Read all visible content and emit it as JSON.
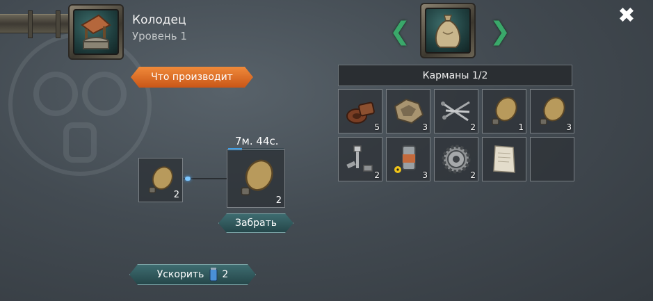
{
  "building": {
    "name": "Колодец",
    "level": "Уровень 1",
    "icon": "well-icon"
  },
  "produces_button": "Что производит",
  "close_icon": "close-icon",
  "storage": {
    "icon": "sack-icon",
    "title": "Карманы 1/2",
    "slots": [
      {
        "icon": "leather-icon",
        "qty": "5"
      },
      {
        "icon": "fabric-scraps-icon",
        "qty": "3"
      },
      {
        "icon": "nails-icon",
        "qty": "2"
      },
      {
        "icon": "water-flask-icon",
        "qty": "1"
      },
      {
        "icon": "water-flask-icon",
        "qty": "3"
      },
      {
        "icon": "bolts-icon",
        "qty": "2"
      },
      {
        "icon": "radioactive-canister-icon",
        "qty": "3"
      },
      {
        "icon": "gear-icon",
        "qty": "2"
      },
      {
        "icon": "paper-sheet-icon",
        "qty": ""
      },
      {
        "icon": "empty-slot",
        "qty": ""
      }
    ]
  },
  "production": {
    "input": {
      "icon": "water-flask-icon",
      "qty": "2"
    },
    "output": {
      "icon": "water-flask-icon",
      "qty": "2"
    },
    "timer": "7м. 44с.",
    "progress": 0.25,
    "collect_button": "Забрать"
  },
  "speedup": {
    "label": "Ускорить",
    "icon": "energy-can-icon",
    "cost": "2"
  },
  "colors": {
    "accent_orange": "#e0702a",
    "button_teal": "#34595c",
    "arrow_green": "#3aa86a",
    "progress_blue": "#3fa0e8"
  }
}
